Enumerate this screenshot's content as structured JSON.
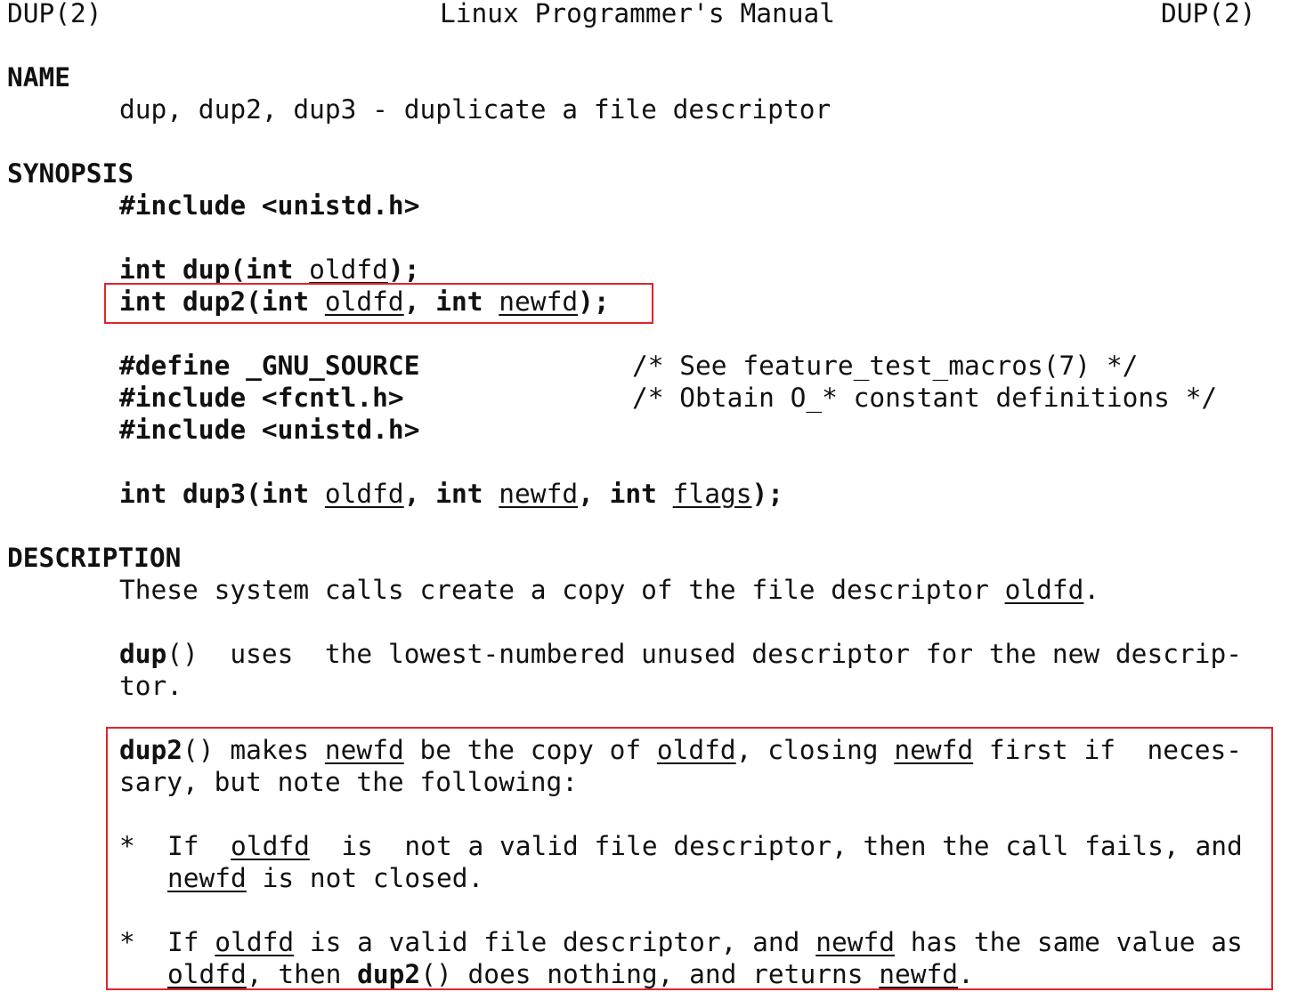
{
  "header": {
    "left": "DUP(2)",
    "center": "Linux Programmer's Manual",
    "right": "DUP(2)"
  },
  "name": {
    "heading": "NAME",
    "line": "dup, dup2, dup3 - duplicate a file descriptor"
  },
  "synopsis": {
    "heading": "SYNOPSIS",
    "include_unistd": "#include <unistd.h>",
    "dup": {
      "a": "int dup(int ",
      "oldfd": "oldfd",
      "b": ");"
    },
    "dup2": {
      "a": "int dup2(int ",
      "oldfd": "oldfd",
      "b": ", int ",
      "newfd": "newfd",
      "c": ");"
    },
    "define_gnu": "#define _GNU_SOURCE",
    "define_comment": "/* See feature_test_macros(7) */",
    "include_fcntl": "#include <fcntl.h>",
    "fcntl_comment": "/* Obtain O_* constant definitions */",
    "include_unistd2": "#include <unistd.h>",
    "dup3": {
      "a": "int dup3(int ",
      "oldfd": "oldfd",
      "b": ", int ",
      "newfd": "newfd",
      "c": ", int ",
      "flags": "flags",
      "d": ");"
    }
  },
  "description": {
    "heading": "DESCRIPTION",
    "p1": {
      "a": "These system calls create a copy of the file descriptor ",
      "oldfd": "oldfd",
      "b": "."
    },
    "p2": {
      "dup": "dup",
      "a": "()  uses  the lowest-numbered unused descriptor for the new descrip-",
      "line2": "tor."
    },
    "p3": {
      "dup2": "dup2",
      "a": "() makes ",
      "newfd": "newfd",
      "b": " be the copy of ",
      "oldfd": "oldfd",
      "c": ", closing ",
      "newfd2": "newfd",
      "d": " first if  neces-",
      "line2": "sary, but note the following:"
    },
    "bullet1": {
      "star": "*",
      "a": "If  ",
      "oldfd": "oldfd",
      "b": "  is  not a valid file descriptor, then the call fails, and",
      "newfd": "newfd",
      "c": " is not closed."
    },
    "bullet2": {
      "star": "*",
      "a": "If ",
      "oldfd": "oldfd",
      "b": " is a valid file descriptor, and ",
      "newfd": "newfd",
      "c": " has the same value as",
      "oldfd2": "oldfd",
      "d": ", then ",
      "dup2": "dup2",
      "e": "() does nothing, and returns ",
      "newfd2": "newfd",
      "f": "."
    }
  }
}
